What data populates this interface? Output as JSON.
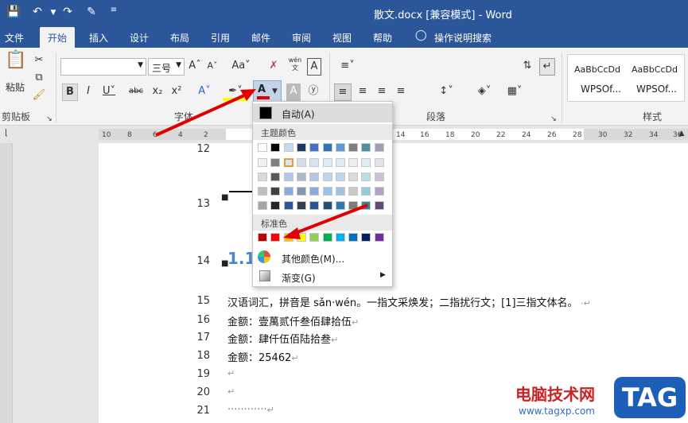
{
  "titlebar": {
    "title": "散文.docx [兼容模式]  -  Word",
    "save_icon": "save-icon",
    "undo_icon": "undo-icon",
    "redo_icon": "redo-icon"
  },
  "tabs": [
    {
      "label": "文件"
    },
    {
      "label": "开始"
    },
    {
      "label": "插入"
    },
    {
      "label": "设计"
    },
    {
      "label": "布局"
    },
    {
      "label": "引用"
    },
    {
      "label": "邮件"
    },
    {
      "label": "审阅"
    },
    {
      "label": "视图"
    },
    {
      "label": "帮助"
    },
    {
      "label": "操作说明搜索"
    }
  ],
  "ribbon": {
    "clipboard": {
      "paste_label": "粘贴",
      "group_label": "剪贴板"
    },
    "font": {
      "name_value": "",
      "size_value": "三号",
      "group_label": "字体",
      "wen_label": "wén"
    },
    "paragraph": {
      "group_label": "段落"
    },
    "styles": {
      "item1_top": "AaBbCcDd",
      "item1_name": "WPSOf...",
      "item2_top": "AaBbCcDd",
      "item2_name": "WPSOf...",
      "group_label": "样式"
    }
  },
  "ruler": {
    "ticks": [
      "10",
      "8",
      "6",
      "4",
      "2",
      "14",
      "16",
      "18",
      "20",
      "22",
      "24",
      "26",
      "28",
      "30",
      "32",
      "34",
      "36"
    ]
  },
  "dropdown": {
    "auto_label": "自动(A)",
    "theme_label": "主题颜色",
    "standard_label": "标准色",
    "more_label": "其他颜色(M)...",
    "gradient_label": "渐变(G)",
    "theme_top": [
      "#ffffff",
      "#000000",
      "#c6d9f0",
      "#1f3864",
      "#4472c4",
      "#2e75b6",
      "#5b9bd5",
      "#7f7f7f",
      "#4e8fa6",
      "#9e9eb4"
    ],
    "theme_cols": [
      [
        "#f2f2f2",
        "#d9d9d9",
        "#bfbfbf",
        "#a6a6a6"
      ],
      [
        "#7f7f7f",
        "#595959",
        "#404040",
        "#262626"
      ],
      [
        "#dae3f3",
        "#b4c7e7",
        "#8faadc",
        "#2f5597"
      ],
      [
        "#d6dce5",
        "#adb9ca",
        "#8497b0",
        "#333f50"
      ],
      [
        "#d9e2f3",
        "#b4c6e7",
        "#8eaadb",
        "#2f5496"
      ],
      [
        "#deebf7",
        "#bdd7ee",
        "#9dc3e6",
        "#1f4e79"
      ],
      [
        "#deebf7",
        "#bdd7ee",
        "#9dc3e6",
        "#2e75b6"
      ],
      [
        "#ededed",
        "#dbdbdb",
        "#c9c9c9",
        "#7b7b7b"
      ],
      [
        "#daeef3",
        "#b7dee8",
        "#92cddc",
        "#31849b"
      ],
      [
        "#e5e0ec",
        "#ccc1da",
        "#b2a2c7",
        "#5f497a"
      ]
    ],
    "standard": [
      "#c00000",
      "#ff0000",
      "#ffc000",
      "#ffff00",
      "#92d050",
      "#00b050",
      "#00b0f0",
      "#0070c0",
      "#002060",
      "#7030a0"
    ]
  },
  "document": {
    "line_numbers": [
      "12",
      "13",
      "14",
      "15",
      "16",
      "17",
      "18",
      "19",
      "20",
      "21"
    ],
    "heading": "1.1",
    "lines": [
      "汉语词汇，拼音是 sǎn·wén。一指文采焕发；二指扰行文；[1]三指文体名。",
      "金额：壹萬贰仟叁佰肆拾伍",
      "金额：肆仟伍佰陆拾叁",
      "金额：25462",
      "",
      "",
      "············"
    ]
  },
  "watermark": {
    "cn": "电脑技术网",
    "tag": "TAG",
    "url": "www.tagxp.com"
  }
}
